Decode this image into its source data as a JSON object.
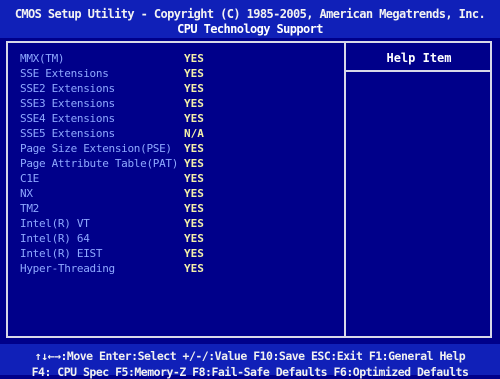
{
  "header": {
    "title": "CMOS Setup Utility - Copyright (C) 1985-2005, American Megatrends, Inc.",
    "subtitle": "CPU Technology Support"
  },
  "settings": [
    {
      "label": "MMX(TM)",
      "value": "YES"
    },
    {
      "label": "SSE Extensions",
      "value": "YES"
    },
    {
      "label": "SSE2 Extensions",
      "value": "YES"
    },
    {
      "label": "SSE3 Extensions",
      "value": "YES"
    },
    {
      "label": "SSE4 Extensions",
      "value": "YES"
    },
    {
      "label": "SSE5 Extensions",
      "value": "N/A"
    },
    {
      "label": "Page Size Extension(PSE)",
      "value": "YES"
    },
    {
      "label": "Page Attribute Table(PAT)",
      "value": "YES"
    },
    {
      "label": "C1E",
      "value": "YES"
    },
    {
      "label": "NX",
      "value": "YES"
    },
    {
      "label": "TM2",
      "value": "YES"
    },
    {
      "label": "Intel(R) VT",
      "value": "YES"
    },
    {
      "label": "Intel(R) 64",
      "value": "YES"
    },
    {
      "label": "Intel(R) EIST",
      "value": "YES"
    },
    {
      "label": "Hyper-Threading",
      "value": "YES"
    }
  ],
  "help": {
    "title": "Help Item"
  },
  "footer": {
    "line1": "↑↓←→:Move  Enter:Select  +/-/:Value  F10:Save  ESC:Exit  F1:General Help",
    "line2": "F4: CPU Spec   F5:Memory-Z   F8:Fail-Safe Defaults   F6:Optimized Defaults"
  },
  "colors": {
    "background": "#00008a",
    "header_bar": "#1020b8",
    "label_text": "#8ea8ff",
    "value_text": "#f4f1a8",
    "border": "#d8d8e8"
  }
}
